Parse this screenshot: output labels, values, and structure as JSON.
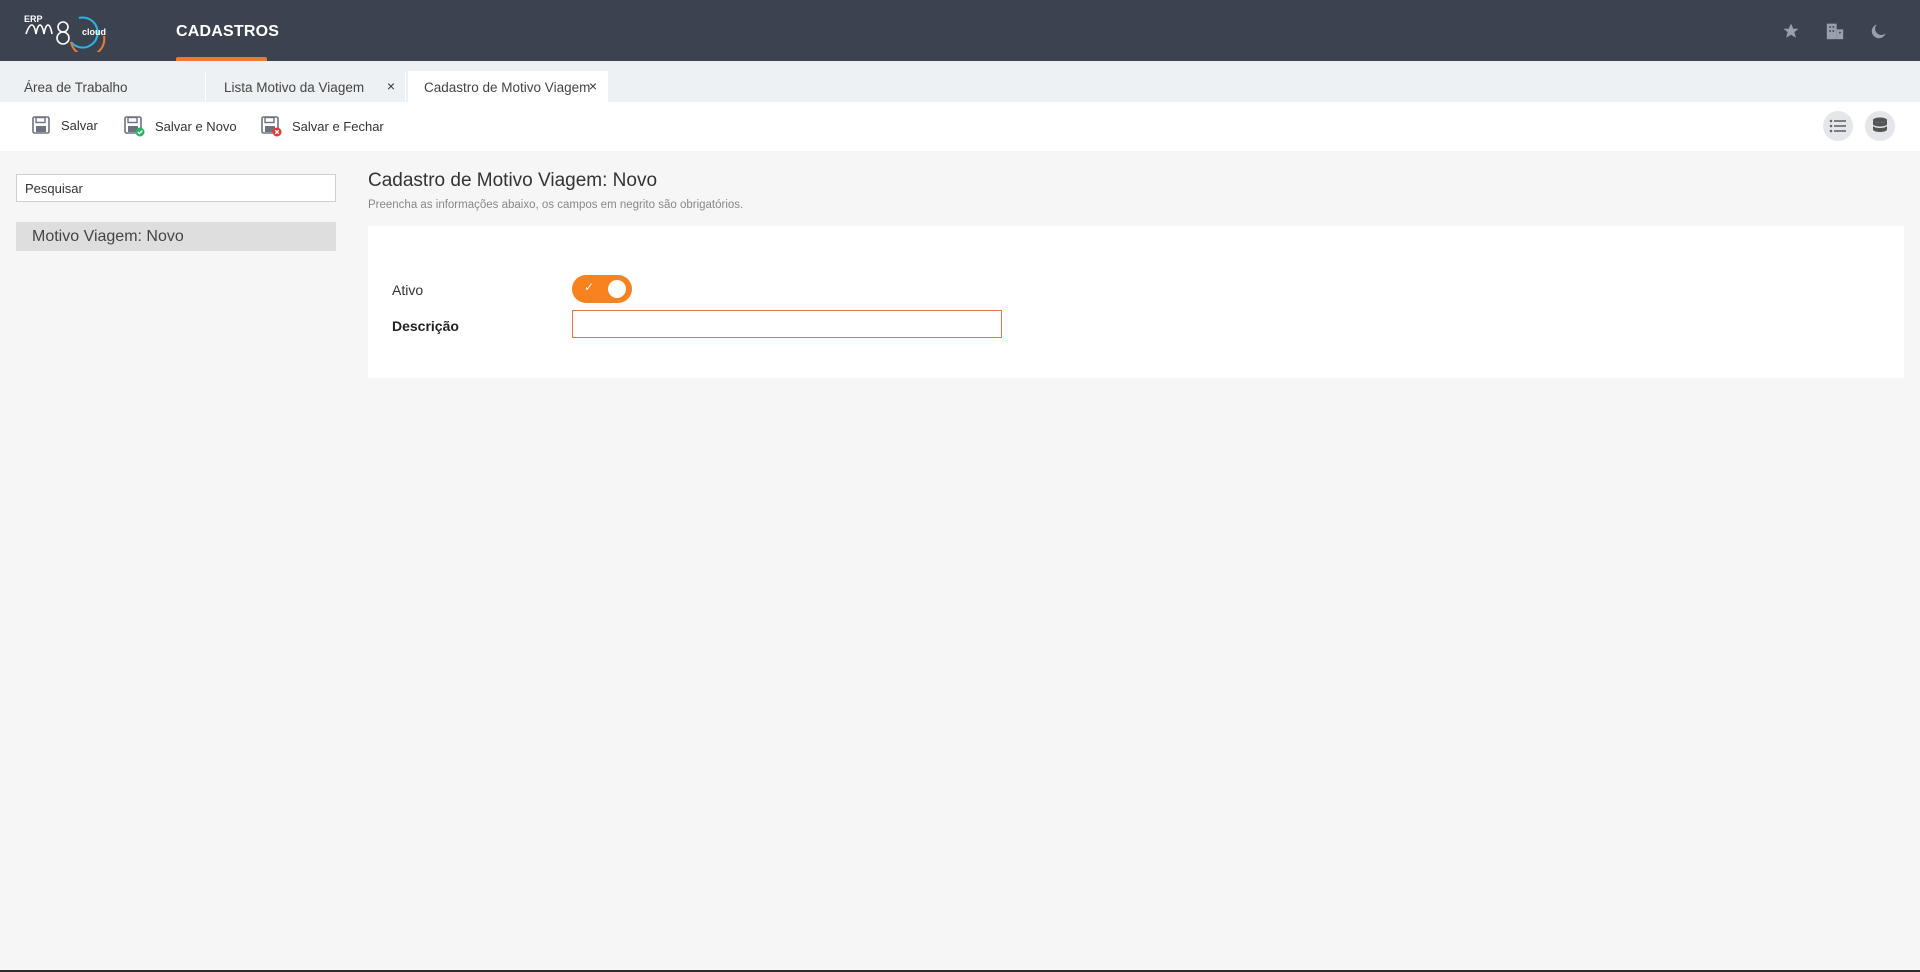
{
  "header": {
    "logo_erp": "ERP",
    "logo_text": "cloud",
    "module_title": "CADASTROS",
    "icons": [
      "star-icon",
      "building-icon",
      "moon-icon"
    ]
  },
  "tabs": [
    {
      "label": "Área de Trabalho",
      "closable": false,
      "active": false
    },
    {
      "label": "Lista Motivo da Viagem",
      "closable": true,
      "active": false
    },
    {
      "label": "Cadastro de Motivo Viagem",
      "closable": true,
      "active": true
    }
  ],
  "tab_close_glyph": "×",
  "toolbar": {
    "save_label": "Salvar",
    "save_new_label": "Salvar e Novo",
    "save_close_label": "Salvar e Fechar"
  },
  "sidebar": {
    "search_placeholder": "Pesquisar",
    "items": [
      {
        "label": "Motivo Viagem: Novo"
      }
    ]
  },
  "main": {
    "title": "Cadastro de Motivo Viagem: Novo",
    "subtitle": "Preencha as informações abaixo, os campos em negrito são obrigatórios.",
    "fields": {
      "ativo_label": "Ativo",
      "ativo_value": true,
      "ativo_check": "✓",
      "descricao_label": "Descrição",
      "descricao_value": ""
    }
  },
  "colors": {
    "topbar": "#3c4350",
    "accent": "#f7821e",
    "required_border": "#e2784a"
  }
}
